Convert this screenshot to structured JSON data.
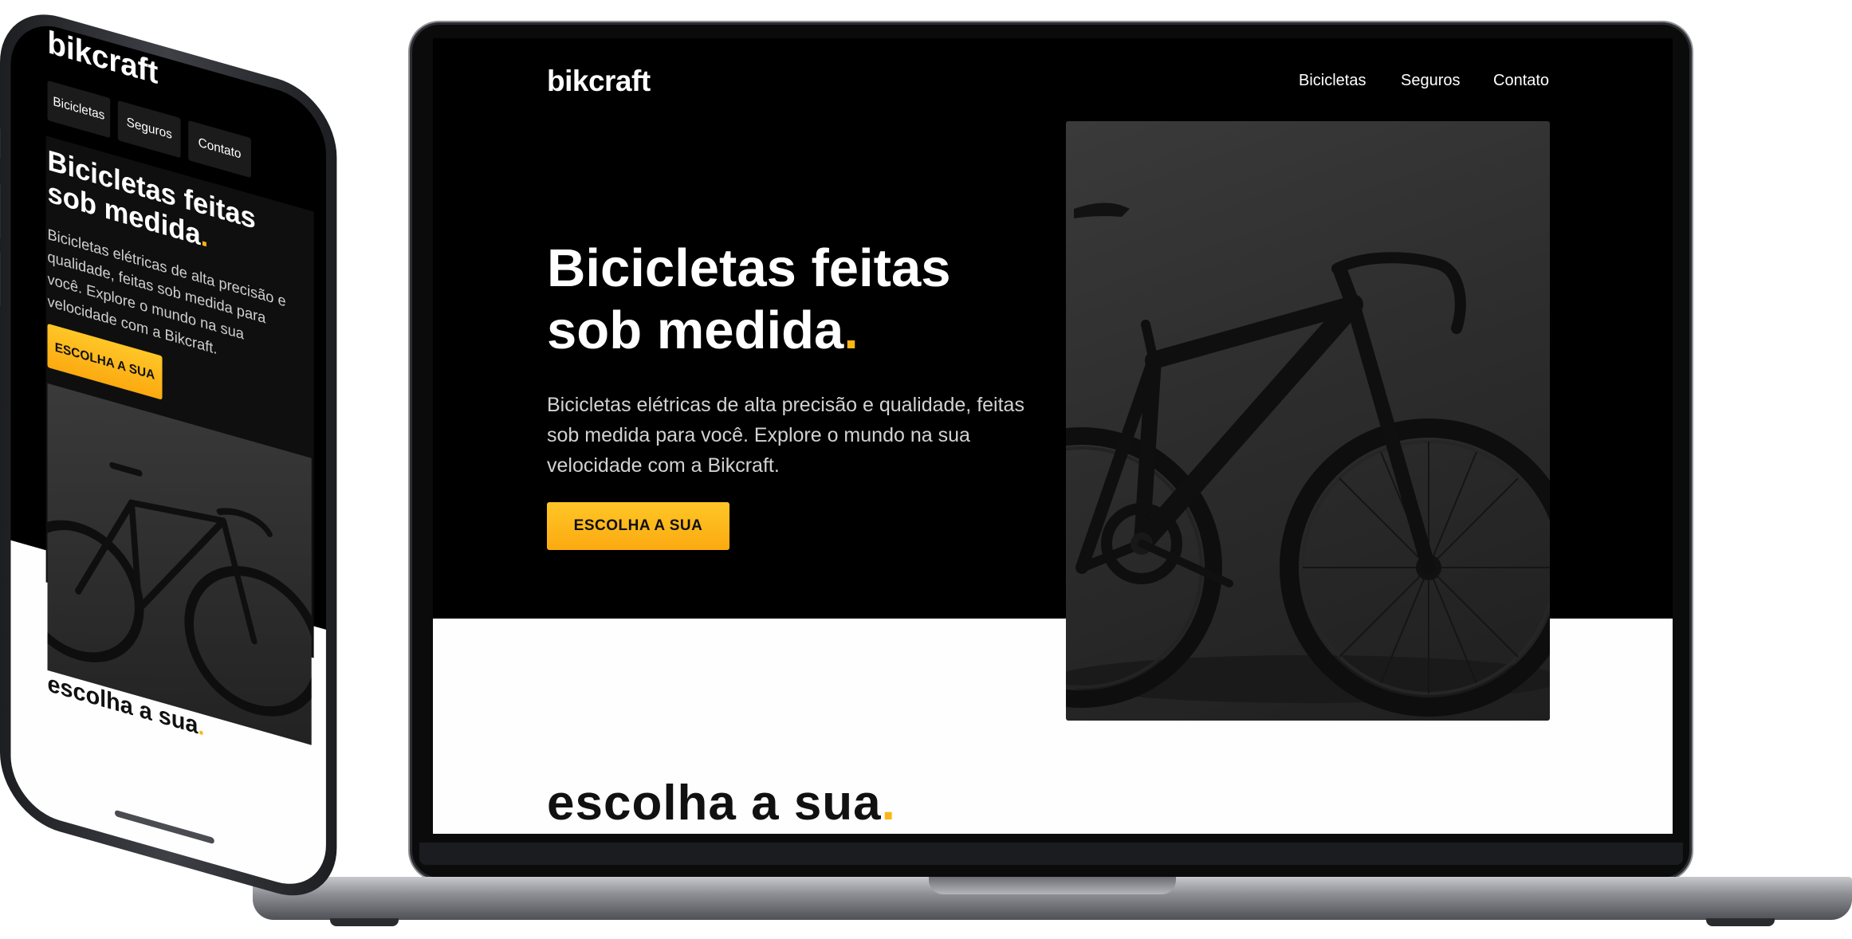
{
  "site": {
    "logo": "bikcraft",
    "nav": [
      "Bicicletas",
      "Seguros",
      "Contato"
    ],
    "hero": {
      "title": "Bicicletas feitas sob medida",
      "title_dot": ".",
      "description": "Bicicletas elétricas de alta precisão e qualidade, feitas sob medida para você. Explore o mundo na sua velocidade com a Bikcraft.",
      "cta": "ESCOLHA A SUA"
    },
    "section_title": "escolha a sua",
    "section_dot": "."
  },
  "colors": {
    "accent": "#FBB616",
    "background": "#000000"
  }
}
